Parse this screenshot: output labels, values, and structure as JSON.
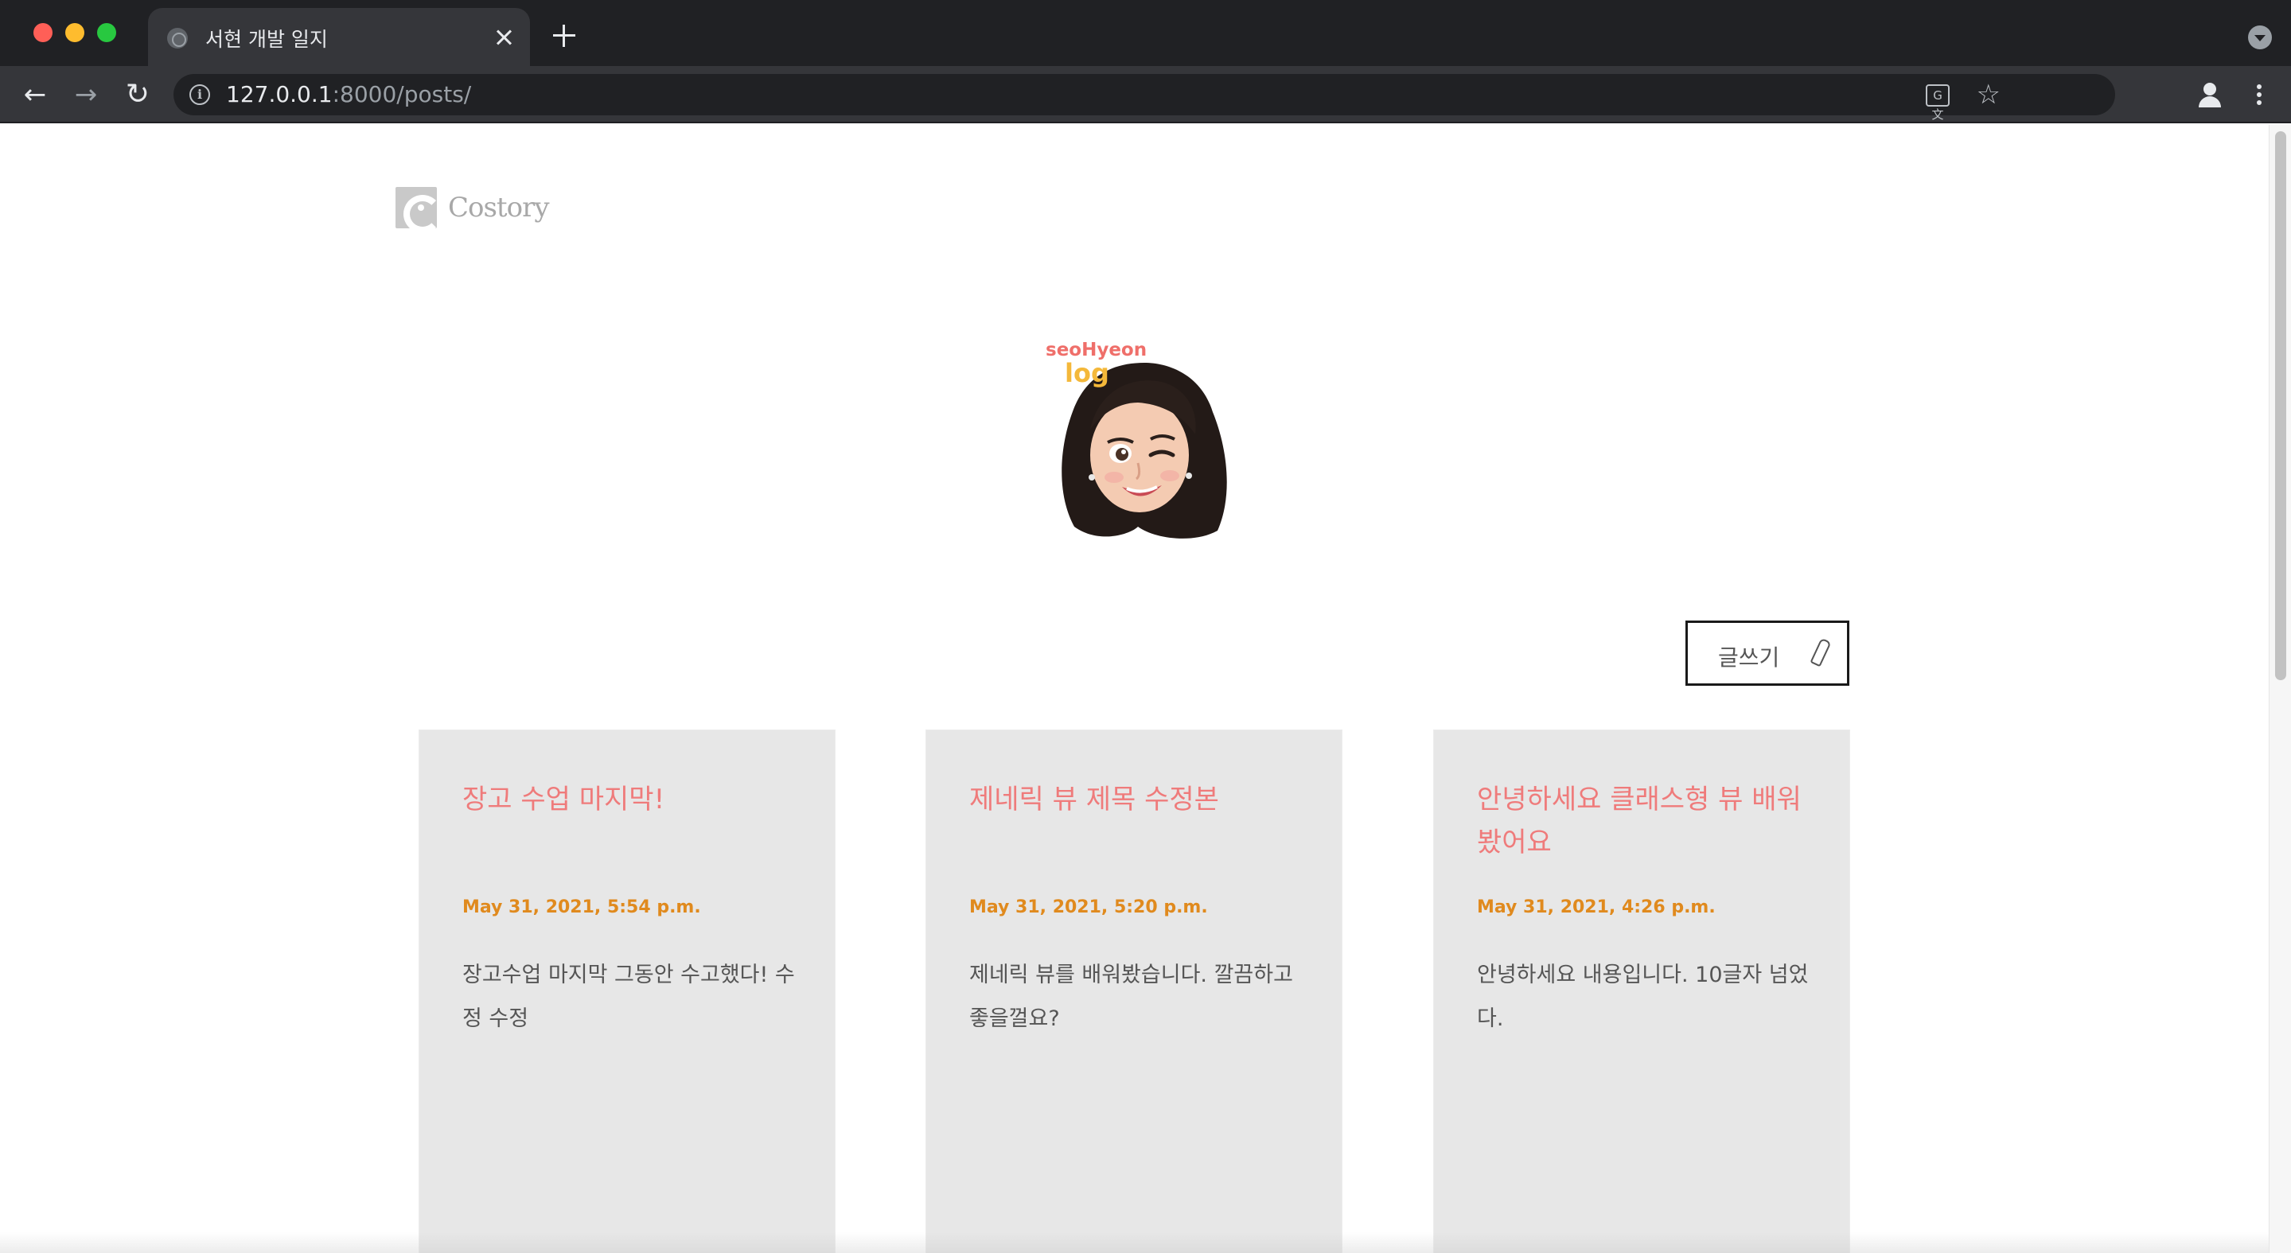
{
  "browser": {
    "tab_title": "서현 개발 일지",
    "url_host": "127.0.0.1",
    "url_path": ":8000/posts/",
    "translate_glyph": "G文"
  },
  "site": {
    "logo_text": "Costory",
    "brand_line1": "seoHyeon",
    "brand_line2": "log",
    "write_button": "글쓰기"
  },
  "posts": [
    {
      "title": "장고 수업 마지막!",
      "date": "May 31, 2021, 5:54 p.m.",
      "body": "장고수업 마지막 그동안 수고했다! 수정 수정"
    },
    {
      "title": "제네릭 뷰 제목 수정본",
      "date": "May 31, 2021, 5:20 p.m.",
      "body": "제네릭 뷰를 배워봤습니다. 깔끔하고 좋을껄요?"
    },
    {
      "title": "안녕하세요 클래스형 뷰 배워 봤어요",
      "date": "May 31, 2021, 4:26 p.m.",
      "body": "안녕하세요 내용입니다. 10글자 넘었다."
    }
  ],
  "colors": {
    "post_title": "#ef7b7b",
    "post_date": "#e08a1e",
    "card_bg": "#e7e7e7"
  }
}
